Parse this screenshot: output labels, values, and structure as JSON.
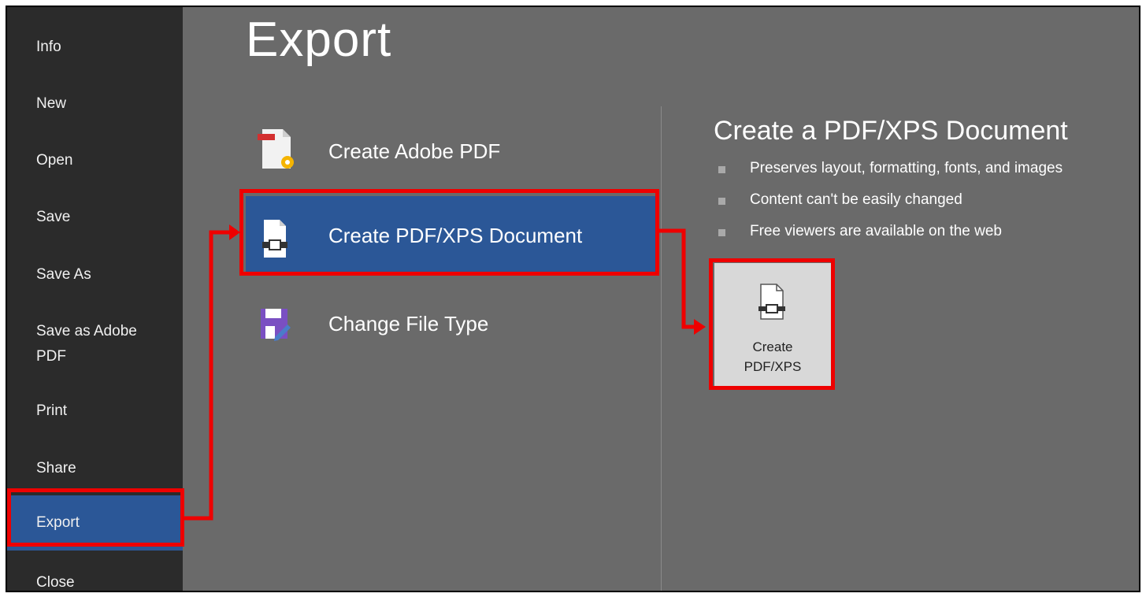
{
  "sidebar": {
    "items": [
      {
        "label": "Info"
      },
      {
        "label": "New"
      },
      {
        "label": "Open"
      },
      {
        "label": "Save"
      },
      {
        "label": "Save As"
      },
      {
        "label": "Save as Adobe\nPDF"
      },
      {
        "label": "Print"
      },
      {
        "label": "Share"
      },
      {
        "label": "Export"
      },
      {
        "label": "Close"
      }
    ],
    "active": "Export"
  },
  "main": {
    "title": "Export",
    "options": [
      {
        "label": "Create Adobe PDF",
        "icon": "adobe-pdf-icon"
      },
      {
        "label": "Create PDF/XPS Document",
        "icon": "pdf-xps-document-icon",
        "selected": true
      },
      {
        "label": "Change File Type",
        "icon": "change-file-type-icon"
      }
    ]
  },
  "detail": {
    "title": "Create a PDF/XPS Document",
    "bullets": [
      "Preserves layout, formatting, fonts, and images",
      "Content can't be easily changed",
      "Free viewers are available on the web"
    ],
    "button": {
      "line1": "Create",
      "line2": "PDF/XPS",
      "icon": "pdf-xps-document-icon"
    }
  },
  "colors": {
    "sidebar_bg": "#2b2b2b",
    "main_bg": "#6a6a6a",
    "selected_bg": "#2b5797",
    "annotation": "#ee0000",
    "button_bg": "#d8d8d8"
  }
}
